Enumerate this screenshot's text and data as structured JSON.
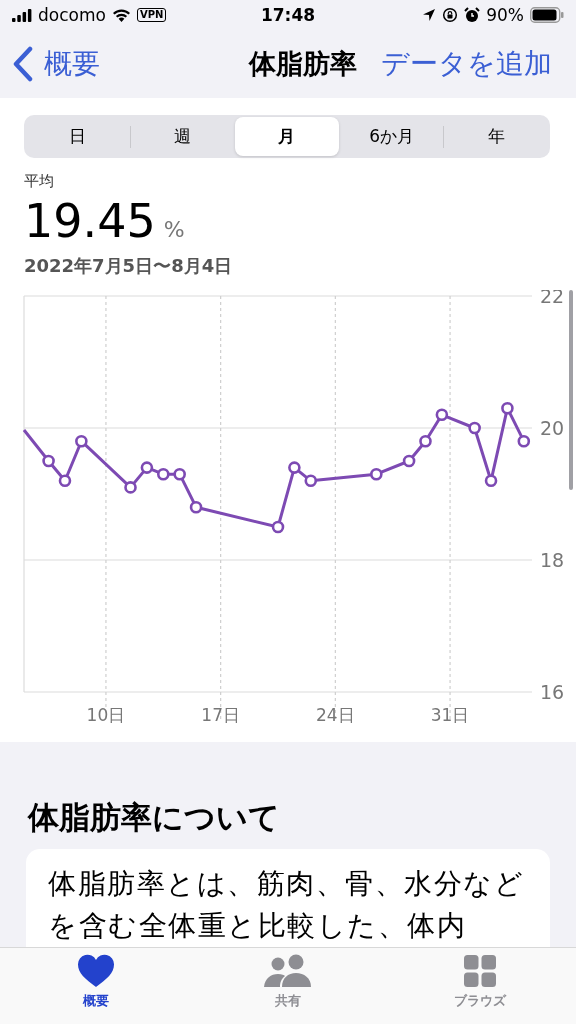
{
  "status_bar": {
    "carrier": "docomo",
    "vpn": "VPN",
    "time": "17:48",
    "battery": "90%"
  },
  "nav": {
    "back": "概要",
    "title": "体脂肪率",
    "action": "データを追加"
  },
  "range_tabs": [
    {
      "label": "日",
      "selected": false
    },
    {
      "label": "週",
      "selected": false
    },
    {
      "label": "月",
      "selected": true
    },
    {
      "label": "6か月",
      "selected": false
    },
    {
      "label": "年",
      "selected": false
    }
  ],
  "summary": {
    "label": "平均",
    "value": "19.45",
    "unit": "%",
    "date_range": "2022年7月5日〜8月4日"
  },
  "chart": {
    "chart_data": {
      "type": "line",
      "xlim": [
        5,
        36
      ],
      "ylim": [
        16,
        22
      ],
      "xticks": [
        {
          "value": 10,
          "label": "10日"
        },
        {
          "value": 17,
          "label": "17日"
        },
        {
          "value": 24,
          "label": "24日"
        },
        {
          "value": 31,
          "label": "31日"
        }
      ],
      "yticks": [
        16,
        18,
        20,
        22
      ],
      "grid": true,
      "x": [
        5,
        6.5,
        7.5,
        8.5,
        11.5,
        12.5,
        13.5,
        14.5,
        15.5,
        20.5,
        21.5,
        22.5,
        26.5,
        28.5,
        29.5,
        30.5,
        32.5,
        33.5,
        34.5,
        35.5
      ],
      "series": [
        {
          "color": "#7d4ab3",
          "marker": "circle",
          "values": [
            19.97,
            19.5,
            19.2,
            19.8,
            19.1,
            19.4,
            19.3,
            19.3,
            18.8,
            18.5,
            19.4,
            19.2,
            19.3,
            19.5,
            19.8,
            20.2,
            20.0,
            19.2,
            20.3,
            19.8
          ]
        }
      ]
    }
  },
  "about": {
    "heading": "体脂肪率について",
    "text": "体脂肪率とは、筋肉、骨、水分などを含む全体重と比較した、体内"
  },
  "tab_bar": [
    {
      "label": "概要",
      "kind": "heart",
      "selected": true
    },
    {
      "label": "共有",
      "kind": "people",
      "selected": false
    },
    {
      "label": "ブラウズ",
      "kind": "grid",
      "selected": false
    }
  ]
}
